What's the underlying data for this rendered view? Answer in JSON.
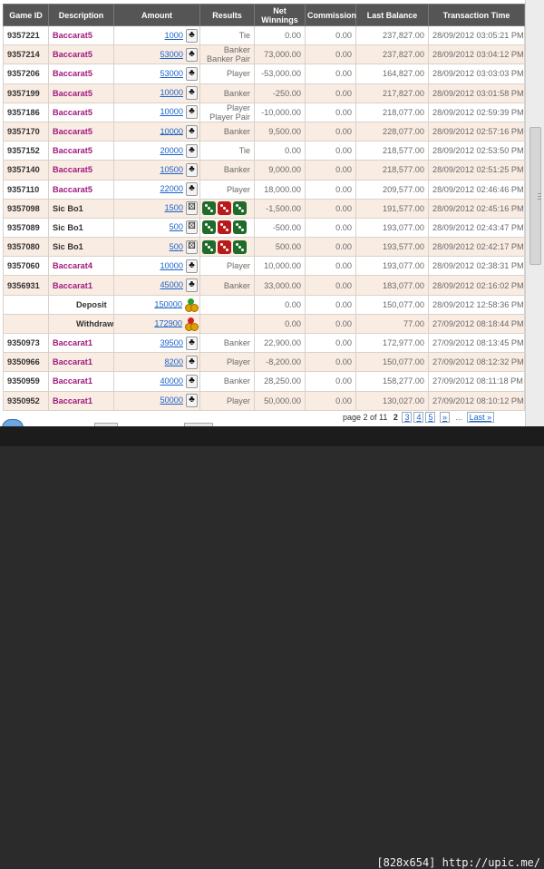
{
  "headers": [
    "Game ID",
    "Description",
    "Amount",
    "Results",
    "Net Winnings",
    "Commission",
    "Last Balance",
    "Transaction Time"
  ],
  "rows": [
    {
      "gid": "9357221",
      "desc": "Baccarat5",
      "amount": "1000",
      "icon": "club",
      "results": [
        "Tie"
      ],
      "net": "0.00",
      "comm": "0.00",
      "bal": "237,827.00",
      "time": "28/09/2012 03:05:21 PM"
    },
    {
      "gid": "9357214",
      "desc": "Baccarat5",
      "amount": "53000",
      "icon": "club",
      "results": [
        "Banker",
        "Banker Pair"
      ],
      "net": "73,000.00",
      "comm": "0.00",
      "bal": "237,827.00",
      "time": "28/09/2012 03:04:12 PM"
    },
    {
      "gid": "9357206",
      "desc": "Baccarat5",
      "amount": "53000",
      "icon": "club",
      "results": [
        "Player"
      ],
      "net": "-53,000.00",
      "comm": "0.00",
      "bal": "164,827.00",
      "time": "28/09/2012 03:03:03 PM"
    },
    {
      "gid": "9357199",
      "desc": "Baccarat5",
      "amount": "10000",
      "icon": "club",
      "results": [
        "Banker"
      ],
      "net": "-250.00",
      "comm": "0.00",
      "bal": "217,827.00",
      "time": "28/09/2012 03:01:58 PM"
    },
    {
      "gid": "9357186",
      "desc": "Baccarat5",
      "amount": "10000",
      "icon": "club",
      "results": [
        "Player",
        "Player Pair"
      ],
      "net": "-10,000.00",
      "comm": "0.00",
      "bal": "218,077.00",
      "time": "28/09/2012 02:59:39 PM"
    },
    {
      "gid": "9357170",
      "desc": "Baccarat5",
      "amount": "10000",
      "icon": "club",
      "results": [
        "Banker"
      ],
      "net": "9,500.00",
      "comm": "0.00",
      "bal": "228,077.00",
      "time": "28/09/2012 02:57:16 PM"
    },
    {
      "gid": "9357152",
      "desc": "Baccarat5",
      "amount": "20000",
      "icon": "club",
      "results": [
        "Tie"
      ],
      "net": "0.00",
      "comm": "0.00",
      "bal": "218,577.00",
      "time": "28/09/2012 02:53:50 PM"
    },
    {
      "gid": "9357140",
      "desc": "Baccarat5",
      "amount": "10500",
      "icon": "club",
      "results": [
        "Banker"
      ],
      "net": "9,000.00",
      "comm": "0.00",
      "bal": "218,577.00",
      "time": "28/09/2012 02:51:25 PM"
    },
    {
      "gid": "9357110",
      "desc": "Baccarat5",
      "amount": "22000",
      "icon": "club",
      "results": [
        "Player"
      ],
      "net": "18,000.00",
      "comm": "0.00",
      "bal": "209,577.00",
      "time": "28/09/2012 02:46:46 PM"
    },
    {
      "gid": "9357098",
      "desc": "Sic Bo1",
      "amount": "1500",
      "icon": "dice",
      "dice": [
        "g",
        "r",
        "g"
      ],
      "results": [],
      "net": "-1,500.00",
      "comm": "0.00",
      "bal": "191,577.00",
      "time": "28/09/2012 02:45:16 PM"
    },
    {
      "gid": "9357089",
      "desc": "Sic Bo1",
      "amount": "500",
      "icon": "dice",
      "dice": [
        "g",
        "r",
        "g"
      ],
      "results": [],
      "net": "-500.00",
      "comm": "0.00",
      "bal": "193,077.00",
      "time": "28/09/2012 02:43:47 PM"
    },
    {
      "gid": "9357080",
      "desc": "Sic Bo1",
      "amount": "500",
      "icon": "dice",
      "dice": [
        "g",
        "r",
        "g"
      ],
      "results": [],
      "net": "500.00",
      "comm": "0.00",
      "bal": "193,577.00",
      "time": "28/09/2012 02:42:17 PM"
    },
    {
      "gid": "9357060",
      "desc": "Baccarat4",
      "amount": "10000",
      "icon": "club",
      "results": [
        "Player"
      ],
      "net": "10,000.00",
      "comm": "0.00",
      "bal": "193,077.00",
      "time": "28/09/2012 02:38:31 PM"
    },
    {
      "gid": "9356931",
      "desc": "Baccarat1",
      "amount": "45000",
      "icon": "club",
      "results": [
        "Banker"
      ],
      "net": "33,000.00",
      "comm": "0.00",
      "bal": "183,077.00",
      "time": "28/09/2012 02:16:02 PM"
    },
    {
      "gid": "",
      "desc": "Deposit",
      "amount": "150000",
      "icon": "chips-up",
      "results": [],
      "net": "0.00",
      "comm": "0.00",
      "bal": "150,077.00",
      "time": "28/09/2012 12:58:36 PM"
    },
    {
      "gid": "",
      "desc": "Withdraw",
      "amount": "172900",
      "icon": "chips-down",
      "results": [],
      "net": "0.00",
      "comm": "0.00",
      "bal": "77.00",
      "time": "27/09/2012 08:18:44 PM"
    },
    {
      "gid": "9350973",
      "desc": "Baccarat1",
      "amount": "39500",
      "icon": "club",
      "results": [
        "Banker"
      ],
      "net": "22,900.00",
      "comm": "0.00",
      "bal": "172,977.00",
      "time": "27/09/2012 08:13:45 PM"
    },
    {
      "gid": "9350966",
      "desc": "Baccarat1",
      "amount": "8200",
      "icon": "club",
      "results": [
        "Player"
      ],
      "net": "-8,200.00",
      "comm": "0.00",
      "bal": "150,077.00",
      "time": "27/09/2012 08:12:32 PM"
    },
    {
      "gid": "9350959",
      "desc": "Baccarat1",
      "amount": "40000",
      "icon": "club",
      "results": [
        "Banker"
      ],
      "net": "28,250.00",
      "comm": "0.00",
      "bal": "158,277.00",
      "time": "27/09/2012 08:11:18 PM"
    },
    {
      "gid": "9350952",
      "desc": "Baccarat1",
      "amount": "50000",
      "icon": "club",
      "results": [
        "Player"
      ],
      "net": "50,000.00",
      "comm": "0.00",
      "bal": "130,027.00",
      "time": "27/09/2012 08:10:12 PM"
    }
  ],
  "pager": {
    "label": "page 2 of 11",
    "current": "2",
    "pages": [
      "3",
      "4",
      "5"
    ],
    "next": "»",
    "ellipsis": "...",
    "last": "Last »"
  },
  "watermark": "[828x654] http://upic.me/",
  "colors": {
    "header_bg": "#555555",
    "row_alt": "#f9ece3",
    "game_name": "#a0187e",
    "link": "#1b64c8",
    "dice_green": "#1f6b2a",
    "dice_red": "#b81a1a"
  }
}
